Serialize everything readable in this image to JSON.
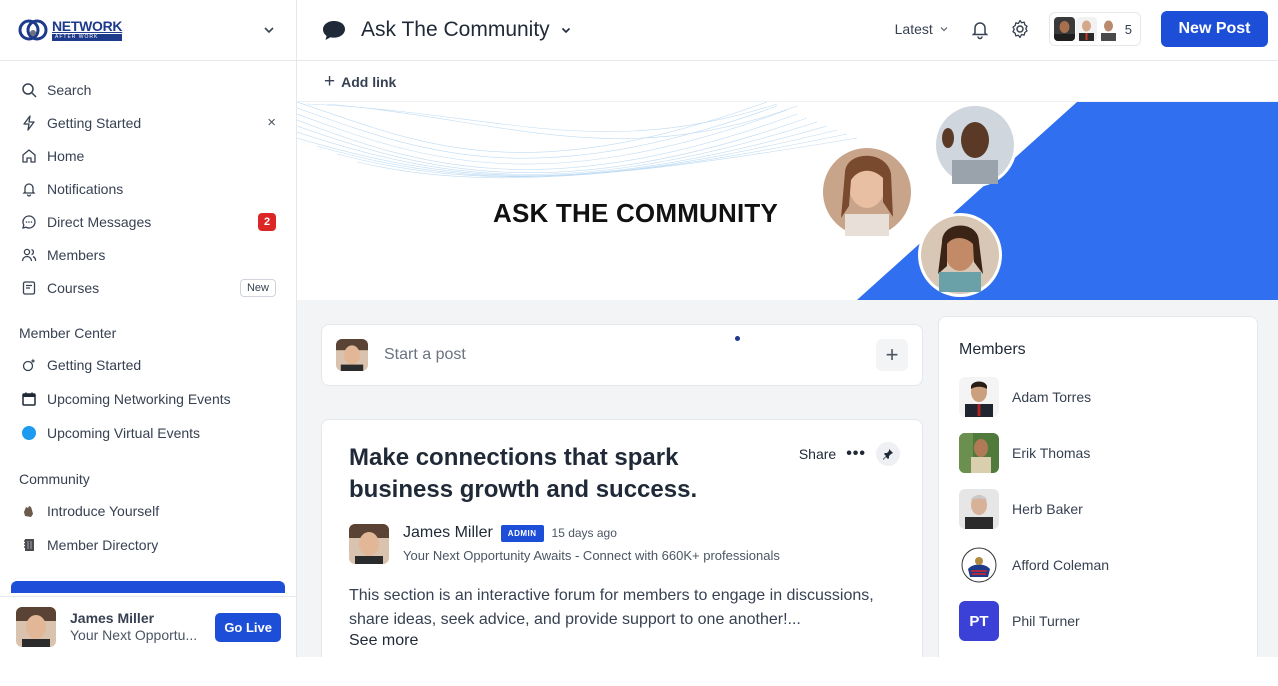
{
  "sidebar": {
    "logo_word": "NETWORK",
    "logo_sub": "AFTER WORK",
    "items": [
      {
        "label": "Search",
        "icon": "search-icon"
      },
      {
        "label": "Getting Started",
        "icon": "bolt-icon",
        "close": "×"
      },
      {
        "label": "Home",
        "icon": "home-icon"
      },
      {
        "label": "Notifications",
        "icon": "bell-icon"
      },
      {
        "label": "Direct Messages",
        "icon": "chat-icon",
        "badge": "2"
      },
      {
        "label": "Members",
        "icon": "users-icon"
      },
      {
        "label": "Courses",
        "icon": "book-icon",
        "badge": "New"
      }
    ],
    "member_center": {
      "title": "Member Center",
      "items": [
        {
          "label": "Getting Started",
          "icon": "sparkle-icon"
        },
        {
          "label": "Upcoming Networking Events",
          "icon": "calendar-icon"
        },
        {
          "label": "Upcoming Virtual Events",
          "icon": "blue-dot-icon"
        }
      ]
    },
    "community": {
      "title": "Community",
      "items": [
        {
          "label": "Introduce Yourself",
          "icon": "wave-icon"
        },
        {
          "label": "Member Directory",
          "icon": "directory-icon"
        }
      ]
    },
    "footer": {
      "name": "James Miller",
      "subtitle": "Your Next Opportu...",
      "go_live": "Go Live"
    }
  },
  "topbar": {
    "title": "Ask The Community",
    "sort": "Latest",
    "member_count": "5",
    "new_post": "New Post"
  },
  "add_link": "Add link",
  "banner": {
    "title": "ASK THE COMMUNITY"
  },
  "composer": {
    "placeholder": "Start a post",
    "plus": "+"
  },
  "post": {
    "title": "Make connections that spark business growth and success.",
    "share": "Share",
    "author": "James Miller",
    "role": "ADMIN",
    "ago": "15 days ago",
    "author_sub": "Your Next Opportunity Awaits - Connect with 660K+ professionals",
    "body": "This section is an interactive forum for members to engage in discussions, share ideas, seek advice, and provide support to one another!...",
    "see_more": "See more"
  },
  "members": {
    "title": "Members",
    "list": [
      {
        "name": "Adam Torres"
      },
      {
        "name": "Erik Thomas"
      },
      {
        "name": "Herb Baker"
      },
      {
        "name": "Afford Coleman"
      },
      {
        "name": "Phil Turner",
        "initials": "PT"
      }
    ]
  },
  "colors": {
    "accent": "#1d4ed8",
    "badge_red": "#dc2626",
    "banner_blue": "#2f6ff0"
  }
}
